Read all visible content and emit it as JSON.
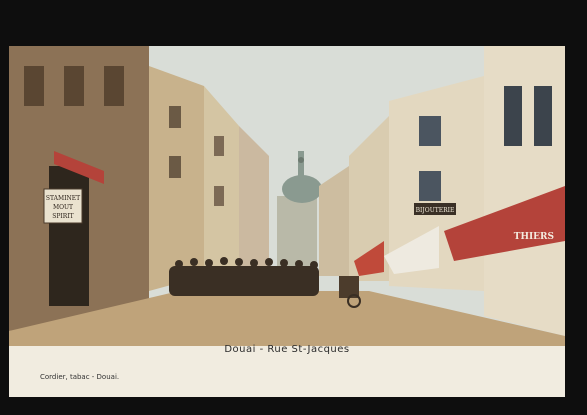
{
  "caption": "Douai - Rue St-Jacques",
  "printer": "Cordier, tabac - Douai.",
  "signs": {
    "shop_left_1": "STAMINET",
    "shop_left_2": "MOUT",
    "shop_left_3": "SPIRIT",
    "bijouterie": "BIJOUTERIE",
    "thiers": "THIERS"
  },
  "colors": {
    "sky": "#d9ddd7",
    "stone": "#c9b38a",
    "awning_red": "#b4433a",
    "street": "#bfa37a",
    "shadow": "#4a3a2b"
  }
}
